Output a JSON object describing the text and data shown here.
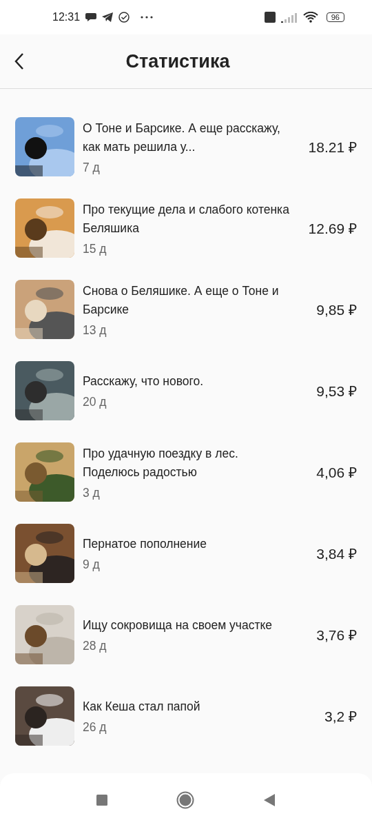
{
  "status_bar": {
    "time": "12:31",
    "battery": "96"
  },
  "header": {
    "title": "Статистика"
  },
  "posts": [
    {
      "title": "О Тоне и Барсике. А еще расскажу, как мать решила у...",
      "age": "7 д",
      "income": "18.21 ₽"
    },
    {
      "title": "Про текущие дела и слабого котенка Беляшика",
      "age": "15 д",
      "income": "12.69 ₽"
    },
    {
      "title": "Снова о Беляшике. А еще о Тоне и Барсике",
      "age": "13 д",
      "income": "9,85 ₽"
    },
    {
      "title": "Расскажу, что нового.",
      "age": "20 д",
      "income": "9,53 ₽"
    },
    {
      "title": "Про удачную поездку в лес. Поделюсь радостью",
      "age": "3 д",
      "income": "4,06 ₽"
    },
    {
      "title": "Пернатое пополнение",
      "age": "9 д",
      "income": "3,84 ₽"
    },
    {
      "title": "Ищу сокровища на своем участке",
      "age": "28 д",
      "income": "3,76 ₽"
    },
    {
      "title": "Как Кеша стал папой",
      "age": "26 д",
      "income": "3,2 ₽"
    }
  ]
}
